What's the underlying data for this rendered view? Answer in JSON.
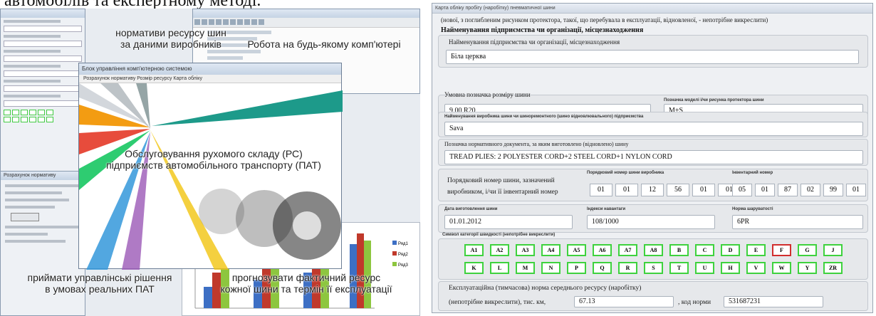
{
  "caption": "автомобілів та експертному методі.",
  "collage": {
    "overlay_top": "нормативи ресурсу шин\nза даними виробників",
    "overlay_pc": "Робота на будь-якому комп'ютері",
    "main_window_title": "Блок управління комп'ютерною системою",
    "main_window_menu": "Розрахунок нормативу   Розмір ресурсу   Карта обліку",
    "overlay_center": "Обслуговування рухомого складу (РС)\nпідприємств автомобільного транспорту (ПАТ)",
    "overlay_bottom_left": "приймати управлінські рішення\nв умовах реальних ПАТ",
    "overlay_bottom_right": "прогнозувати фактичний ресурс\nкожної шини та термін її експлуатації",
    "small_window_title": "Розрахунок нормативу",
    "legend": [
      "Ряд1",
      "Ряд2",
      "Ряд3"
    ],
    "colors": {
      "blue": "#3d6fc4",
      "red": "#c0392b",
      "green": "#8dc63f",
      "teal": "#1d9a8a"
    }
  },
  "card": {
    "window_title": "Карта обліку пробігу (наробітку) пневматичної шини",
    "subtitle": "(нової, з поглибленим рисунком протектора, такої, що перебувала в експлуатації, відновленої, - непотрібне викреслити)",
    "org_header": "Найменування підприємства чи організації, місцезнаходження",
    "org_label": "Найменування підприємства чи організації, місцезнаходження",
    "org_value": "Біла церква",
    "size_label": "Умовна позначка розміру шини",
    "size_value": "9,00 R20",
    "model_label": "Позначка моделі і/чи рисунка протектора шини",
    "model_value": "M+S",
    "maker_label": "Найменування виробника шини чи шиноремонтного (шино відновлювального) підприємства",
    "maker_value": "Sava",
    "doc_label": "Позначка нормативного документа, за яким виготовлено (відновлено) шину",
    "doc_value": "TREAD PLIES: 2 POLYESTER CORD+2 STEEL CORD+1 NYLON CORD",
    "serial_label": "Порядковий номер шини, зазначений виробником, і/чи її інвентарний номер",
    "serial_maker_label": "Порядковий номер шини виробника",
    "serial_maker": [
      "01",
      "01",
      "12",
      "56",
      "01",
      "01"
    ],
    "inventory_label": "Інвентарний номер",
    "inventory": [
      "05",
      "01",
      "87",
      "02",
      "99",
      "01"
    ],
    "date_label": "Дата виготовлення шини",
    "date_value": "01.01.2012",
    "load_label": "Індекси навантаги",
    "load_value": "108/1000",
    "ply_label": "Норма шаруватості",
    "ply_value": "6PR",
    "speed_label": "Символ категорії швидкості (непотрібне викреслити)",
    "speed_row1": [
      "A1",
      "A2",
      "A3",
      "A4",
      "A5",
      "A6",
      "A7",
      "A8",
      "B",
      "C",
      "D",
      "E",
      "F",
      "G",
      "J"
    ],
    "speed_row2": [
      "K",
      "L",
      "M",
      "N",
      "P",
      "Q",
      "R",
      "S",
      "T",
      "U",
      "H",
      "V",
      "W",
      "Y",
      "ZR"
    ],
    "speed_selected": "F",
    "norm_label": "Експлуатаційна (тимчасова) норма середнього ресурсу (наробітку)",
    "norm_unit_label": "(непотрібне викреслити), тис. км,",
    "norm_value": "67.13",
    "code_label": ", код норми",
    "code_value": "531687231"
  }
}
